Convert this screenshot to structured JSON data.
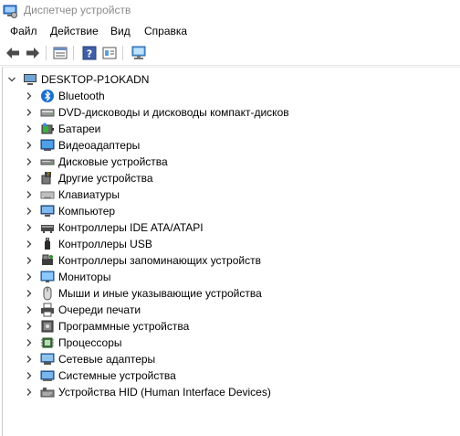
{
  "window": {
    "title": "Диспетчер устройств"
  },
  "menu": [
    "Файл",
    "Действие",
    "Вид",
    "Справка"
  ],
  "toolbar": {
    "buttons": [
      "back-icon",
      "forward-icon",
      "properties-icon",
      "help-icon",
      "view-icon",
      "monitor-scan-icon"
    ]
  },
  "tree": {
    "root": {
      "label": "DESKTOP-P1OKADN",
      "icon": "computer-icon",
      "expanded": true
    },
    "items": [
      {
        "label": "Bluetooth",
        "icon": "bluetooth-icon"
      },
      {
        "label": "DVD-дисководы и дисководы компакт-дисков",
        "icon": "dvd-drive-icon"
      },
      {
        "label": "Батареи",
        "icon": "battery-icon"
      },
      {
        "label": "Видеоадаптеры",
        "icon": "display-adapter-icon"
      },
      {
        "label": "Дисковые устройства",
        "icon": "disk-drive-icon"
      },
      {
        "label": "Другие устройства",
        "icon": "unknown-device-icon"
      },
      {
        "label": "Клавиатуры",
        "icon": "keyboard-icon"
      },
      {
        "label": "Компьютер",
        "icon": "computer-icon"
      },
      {
        "label": "Контроллеры IDE ATA/ATAPI",
        "icon": "ide-controller-icon"
      },
      {
        "label": "Контроллеры USB",
        "icon": "usb-icon"
      },
      {
        "label": "Контроллеры запоминающих устройств",
        "icon": "storage-controller-icon"
      },
      {
        "label": "Мониторы",
        "icon": "monitor-icon"
      },
      {
        "label": "Мыши и иные указывающие устройства",
        "icon": "mouse-icon"
      },
      {
        "label": "Очереди печати",
        "icon": "printer-icon"
      },
      {
        "label": "Программные устройства",
        "icon": "software-device-icon"
      },
      {
        "label": "Процессоры",
        "icon": "processor-icon"
      },
      {
        "label": "Сетевые адаптеры",
        "icon": "network-adapter-icon"
      },
      {
        "label": "Системные устройства",
        "icon": "system-device-icon"
      },
      {
        "label": "Устройства HID (Human Interface Devices)",
        "icon": "hid-icon"
      }
    ]
  }
}
